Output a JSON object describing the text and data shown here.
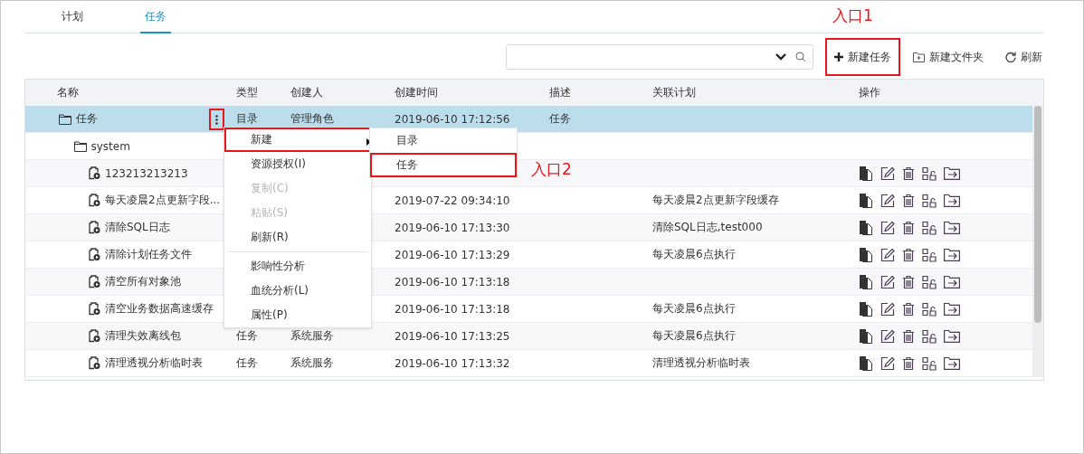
{
  "tabs": [
    {
      "label": "计划",
      "selected": false
    },
    {
      "label": "任务",
      "selected": true
    }
  ],
  "toolbar": {
    "buttons": [
      {
        "kind": "add",
        "label": "新建任务",
        "highlighted": true
      },
      {
        "kind": "folder",
        "label": "新建文件夹",
        "highlighted": false
      },
      {
        "kind": "refresh",
        "label": "刷新",
        "highlighted": false
      }
    ]
  },
  "callouts": [
    {
      "label": "入口1"
    },
    {
      "label": "入口2"
    }
  ],
  "table": {
    "columns": [
      "名称",
      "类型",
      "创建人",
      "创建时间",
      "描述",
      "关联计划",
      "操作"
    ],
    "rows": [
      {
        "kind": "folder",
        "name": "任务",
        "type": "目录",
        "creator": "管理角色",
        "time": "2019-06-10 17:12:56",
        "desc": "任务",
        "selected": true,
        "children": [
          {
            "kind": "folder",
            "name": "system",
            "selected": false,
            "children": [
              {
                "kind": "task",
                "name": "123213213213",
                "selected": false
              },
              {
                "kind": "task",
                "name": "每天凌晨2点更新字段...",
                "time": "2019-07-22 09:34:10",
                "plan": "每天凌晨2点更新字段缓存",
                "selected": false
              },
              {
                "kind": "task",
                "name": "清除SQL日志",
                "time": "2019-06-10 17:13:30",
                "plan": "清除SQL日志,test000",
                "selected": false
              },
              {
                "kind": "task",
                "name": "清除计划任务文件",
                "time": "2019-06-10 17:13:29",
                "plan": "每天凌晨6点执行",
                "selected": false
              },
              {
                "kind": "task",
                "name": "清空所有对象池",
                "time": "2019-06-10 17:13:18",
                "selected": false
              },
              {
                "kind": "task",
                "name": "清空业务数据高速缓存",
                "time": "2019-06-10 17:13:18",
                "plan": "每天凌晨6点执行",
                "selected": false
              },
              {
                "kind": "task",
                "name": "清理失效离线包",
                "type": "任务",
                "creator": "系统服务",
                "time": "2019-06-10 17:13:25",
                "plan": "每天凌晨6点执行",
                "selected": false
              },
              {
                "kind": "task",
                "name": "清理透视分析临时表",
                "type": "任务",
                "creator": "系统服务",
                "time": "2019-06-10 17:13:32",
                "plan": "清理透视分析临时表",
                "selected": false
              }
            ]
          }
        ]
      }
    ]
  },
  "more_button": {
    "highlighted": true
  },
  "context_menu": {
    "groups": [
      [
        {
          "label": "新建",
          "disabled": false,
          "submenu": true,
          "highlighted": true
        },
        {
          "label": "资源授权(I)",
          "disabled": false,
          "submenu": false,
          "highlighted": false
        },
        {
          "label": "复制(C)",
          "disabled": true,
          "submenu": false,
          "highlighted": false
        },
        {
          "label": "粘贴(S)",
          "disabled": true,
          "submenu": false,
          "highlighted": false
        },
        {
          "label": "刷新(R)",
          "disabled": false,
          "submenu": false,
          "highlighted": false
        }
      ],
      [
        {
          "label": "影响性分析",
          "disabled": false,
          "submenu": false,
          "highlighted": false
        },
        {
          "label": "血统分析(L)",
          "disabled": false,
          "submenu": false,
          "highlighted": false
        },
        {
          "label": "属性(P)",
          "disabled": false,
          "submenu": false,
          "highlighted": false
        }
      ]
    ],
    "submenu": [
      {
        "label": "目录",
        "highlighted": false
      },
      {
        "label": "任务",
        "highlighted": true
      }
    ]
  }
}
